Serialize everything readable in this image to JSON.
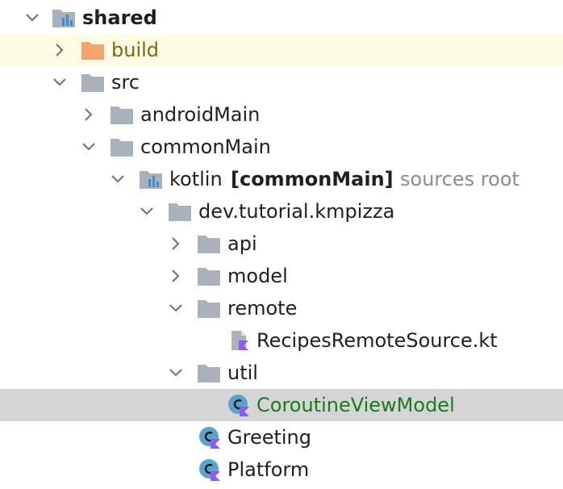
{
  "tree": {
    "shared": {
      "label": "shared"
    },
    "build": {
      "label": "build"
    },
    "src": {
      "label": "src"
    },
    "androidMain": {
      "label": "androidMain"
    },
    "commonMain": {
      "label": "commonMain"
    },
    "kotlin": {
      "label": "kotlin",
      "tag": "[commonMain]",
      "note": "sources root"
    },
    "package": {
      "label": "dev.tutorial.kmpizza"
    },
    "api": {
      "label": "api"
    },
    "model": {
      "label": "model"
    },
    "remote": {
      "label": "remote"
    },
    "recipesRemoteSource": {
      "label": "RecipesRemoteSource.kt"
    },
    "util": {
      "label": "util"
    },
    "coroutineViewModel": {
      "label": "CoroutineViewModel"
    },
    "greeting": {
      "label": "Greeting"
    },
    "platform": {
      "label": "Platform"
    }
  },
  "colors": {
    "folder": "#a9b1ba",
    "excluded_folder": "#f5a470",
    "build_row_bg": "#fdfbe3",
    "selected_row_bg": "#d5d5d5",
    "kotlin_purple": "#8a5cf0",
    "class_circle": "#5aa4cc",
    "modified_text": "#1c7a1c"
  }
}
